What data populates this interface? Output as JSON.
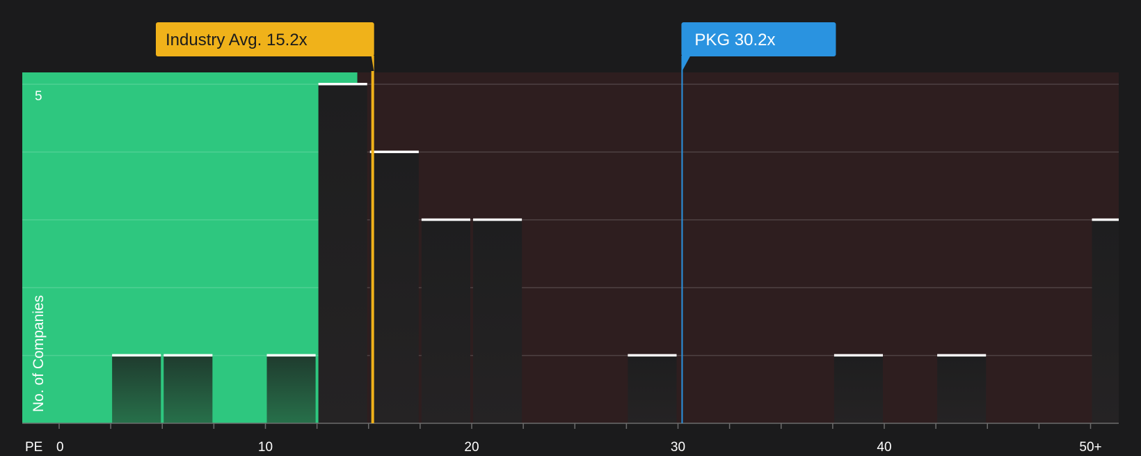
{
  "chart_data": {
    "type": "bar",
    "xlabel": "PE",
    "ylabel": "No. of Companies",
    "x_ticks": [
      "0",
      "10",
      "20",
      "30",
      "40",
      "50+"
    ],
    "y_ticks": [
      "5"
    ],
    "ylim": [
      0,
      5
    ],
    "xlim": [
      0,
      51.3
    ],
    "bin_width": 2.5,
    "bins": [
      {
        "x": 2.5,
        "value": 1
      },
      {
        "x": 5.0,
        "value": 1
      },
      {
        "x": 10.0,
        "value": 1
      },
      {
        "x": 12.5,
        "value": 5
      },
      {
        "x": 15.0,
        "value": 4
      },
      {
        "x": 17.5,
        "value": 3
      },
      {
        "x": 20.0,
        "value": 3
      },
      {
        "x": 27.5,
        "value": 1
      },
      {
        "x": 37.5,
        "value": 1
      },
      {
        "x": 42.5,
        "value": 1
      },
      {
        "x": 50.0,
        "value": 3
      }
    ],
    "markers": [
      {
        "label": "Industry Avg. 15.2x",
        "value": 15.2,
        "color": "#f0b21a"
      },
      {
        "label": "PKG 30.2x",
        "value": 30.2,
        "color": "#2a93e0"
      }
    ],
    "colors": {
      "undervalued_zone": "#2ec77f",
      "overvalued_zone": "#2e1e1f",
      "bar_on_green": "#23503a",
      "bar_on_dark": "#222021"
    }
  }
}
